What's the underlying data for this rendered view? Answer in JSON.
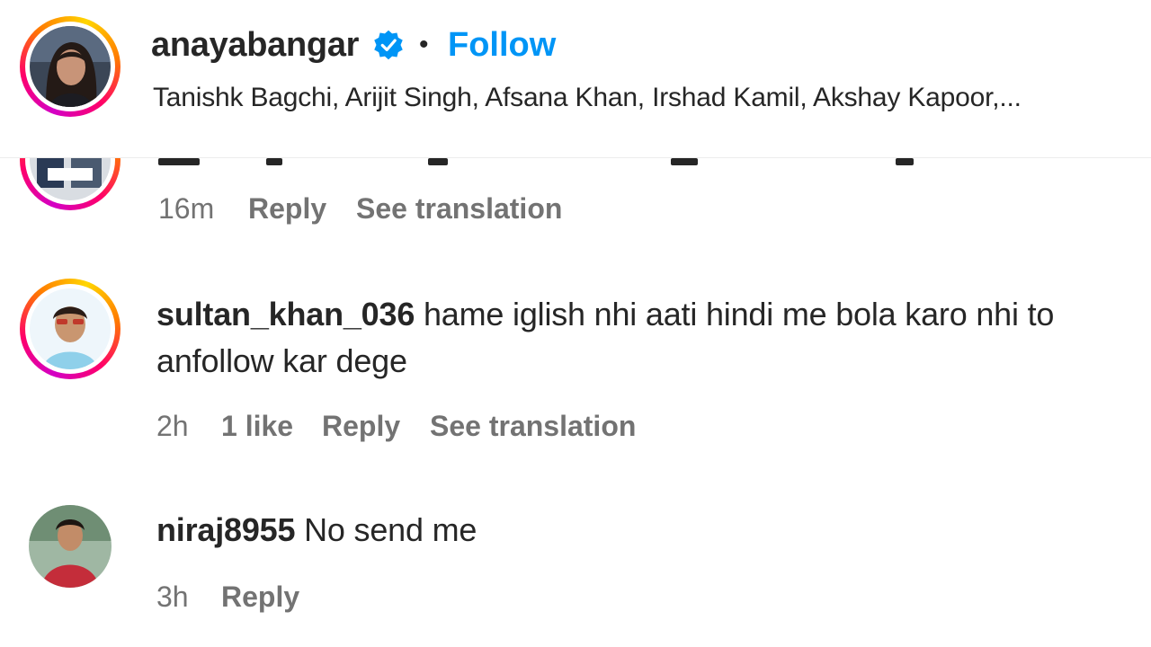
{
  "header": {
    "username": "anayabangar",
    "verified_icon": "verified-badge-icon",
    "separator": "•",
    "follow_label": "Follow",
    "audio_credits": "Tanishk Bagchi, Arijit Singh, Afsana Khan, Irshad Kamil, Akshay Kapoor,..."
  },
  "comments": [
    {
      "time": "16m",
      "reply_label": "Reply",
      "translate_label": "See translation"
    },
    {
      "username": "sultan_khan_036",
      "text_line1": "hame iglish nhi aati hindi me bola karo nhi to",
      "text_line2": "anfollow kar dege",
      "time": "2h",
      "likes": "1 like",
      "reply_label": "Reply",
      "translate_label": "See translation"
    },
    {
      "username": "niraj8955",
      "text": "No send me",
      "time": "3h",
      "reply_label": "Reply"
    }
  ],
  "colors": {
    "follow_blue": "#0095f6",
    "verified_blue": "#0095f6",
    "text_primary": "#262626",
    "text_secondary": "#737373"
  }
}
